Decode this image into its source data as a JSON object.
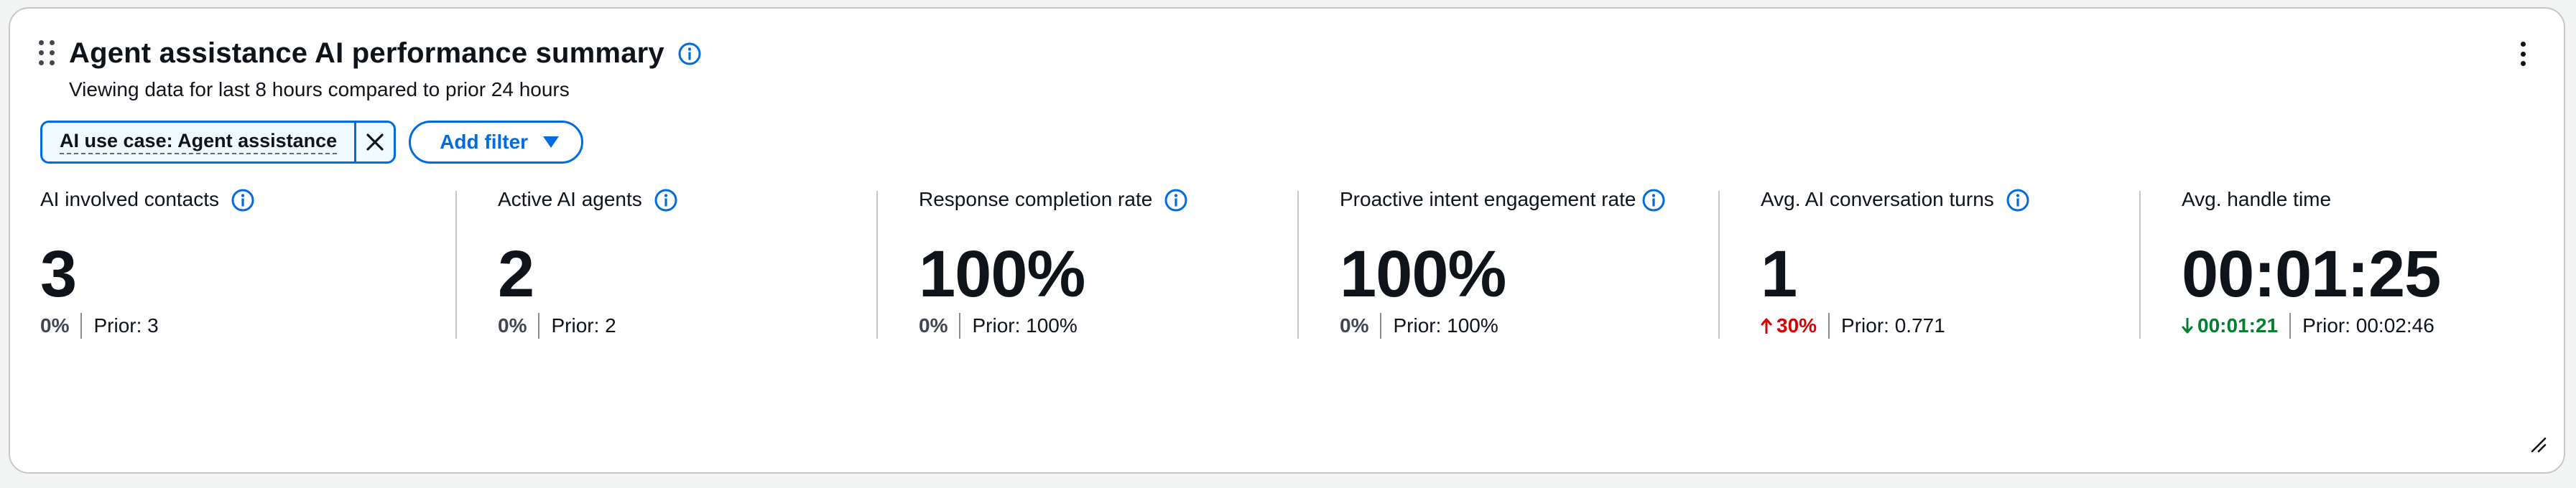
{
  "header": {
    "title": "Agent assistance AI performance summary",
    "subtitle": "Viewing data for last 8 hours compared to prior 24 hours"
  },
  "filters": {
    "token_label": "AI use case: Agent assistance",
    "add_filter_label": "Add filter"
  },
  "metrics": [
    {
      "label": "AI involved contacts",
      "value": "3",
      "change": "0%",
      "prior": "Prior: 3",
      "trend": "neutral",
      "has_info": true
    },
    {
      "label": "Active AI agents",
      "value": "2",
      "change": "0%",
      "prior": "Prior: 2",
      "trend": "neutral",
      "has_info": true
    },
    {
      "label": "Response completion rate",
      "value": "100%",
      "change": "0%",
      "prior": "Prior: 100%",
      "trend": "neutral",
      "has_info": true
    },
    {
      "label": "Proactive intent engagement rate",
      "value": "100%",
      "change": "0%",
      "prior": "Prior: 100%",
      "trend": "neutral",
      "has_info": true
    },
    {
      "label": "Avg. AI conversation turns",
      "value": "1",
      "change": "30%",
      "prior": "Prior: 0.771",
      "trend": "up",
      "has_info": true
    },
    {
      "label": "Avg. handle time",
      "value": "00:01:25",
      "change": "00:01:21",
      "prior": "Prior: 00:02:46",
      "trend": "down",
      "has_info": false
    }
  ],
  "colors": {
    "accent": "#006ce0",
    "increase": "#db0000",
    "decrease": "#00802f"
  },
  "icons": [
    "drag-handle-icon",
    "info-icon",
    "more-options-icon",
    "close-icon",
    "caret-down-icon",
    "arrow-up-icon",
    "arrow-down-icon",
    "resize-handle-icon"
  ]
}
